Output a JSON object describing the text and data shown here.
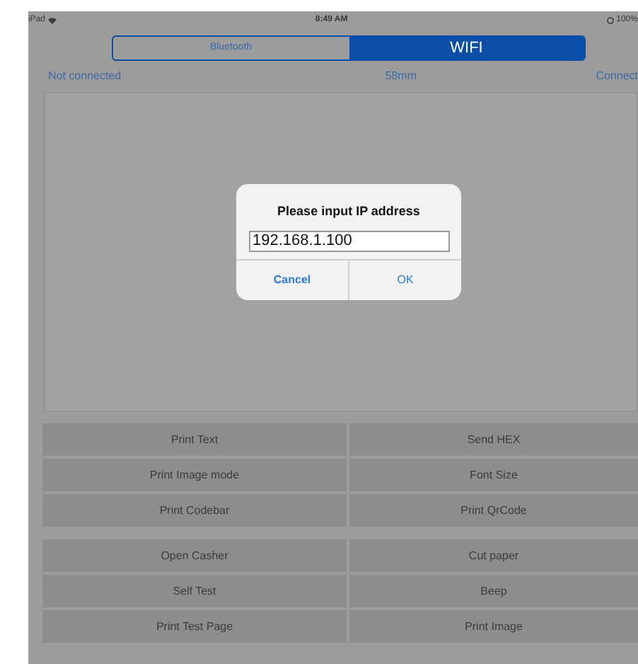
{
  "status_bar": {
    "device": "iPad",
    "time": "8:49 AM",
    "battery": "100%"
  },
  "tabs": [
    {
      "label": "Bluetooth",
      "selected": false
    },
    {
      "label": "WIFI",
      "selected": true
    }
  ],
  "info_row": {
    "connection": "Not connected",
    "paper_width": "58mm",
    "connect_link": "Connect"
  },
  "dialog": {
    "title": "Please input IP address",
    "value": "192.168.1.100",
    "buttons": [
      "Cancel",
      "OK"
    ]
  },
  "button_groups": [
    [
      "Print Text",
      "Send HEX",
      "Print Image mode",
      "Font Size",
      "Print Codebar",
      "Print QrCode"
    ],
    [
      "Open Casher",
      "Cut paper",
      "Self Test",
      "Beep",
      "Print Test Page",
      "Print Image"
    ]
  ]
}
